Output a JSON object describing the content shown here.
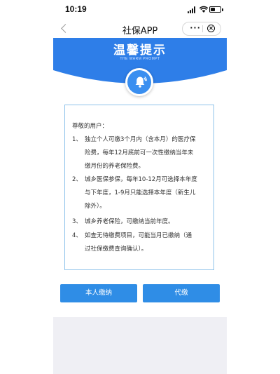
{
  "status_bar": {
    "time": "10:19"
  },
  "title_bar": {
    "title": "社保APP",
    "more_label": "···"
  },
  "banner": {
    "title": "温馨提示",
    "subtitle": "THE WARM PROMPT",
    "icon": "bell-icon"
  },
  "notice": {
    "greeting": "尊敬的用户：",
    "items": [
      {
        "num": "1、",
        "lines": [
          "独立个人可缴3个月内（含本月）的医疗保",
          "险费，每年12月底前可一次性缴纳当年未",
          "缴月份的养老保险费。"
        ]
      },
      {
        "num": "2、",
        "lines": [
          "城乡医保参保，每年10-12月可选择本年度",
          "与下年度，1-9月只能选择本年度（新生儿",
          "除外）。"
        ]
      },
      {
        "num": "3、",
        "lines": [
          "城乡养老保险，可缴纳当前年度。"
        ]
      },
      {
        "num": "4、",
        "lines": [
          "如查无待缴费项目，可能当月已缴纳（通",
          "过社保缴费查询确认）。"
        ]
      }
    ]
  },
  "buttons": {
    "self_pay": "本人缴纳",
    "proxy_pay": "代缴"
  },
  "colors": {
    "banner_blue": "#2e7ee8",
    "button_blue": "#2f8de6",
    "notice_border": "#8ec2ea"
  }
}
